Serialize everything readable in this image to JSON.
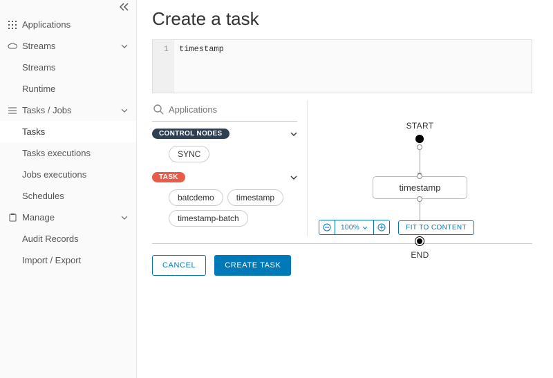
{
  "sidebar": {
    "applications": "Applications",
    "streams": {
      "label": "Streams",
      "items": [
        "Streams",
        "Runtime"
      ]
    },
    "tasks": {
      "label": "Tasks / Jobs",
      "items": [
        "Tasks",
        "Tasks executions",
        "Jobs executions",
        "Schedules"
      ]
    },
    "manage": {
      "label": "Manage",
      "items": [
        "Audit Records",
        "Import / Export"
      ]
    }
  },
  "page": {
    "title": "Create a task"
  },
  "editor": {
    "line_no": "1",
    "content": "timestamp"
  },
  "palette": {
    "search_placeholder": "Applications",
    "control_nodes": {
      "label": "CONTROL NODES",
      "items": [
        "SYNC"
      ]
    },
    "task": {
      "label": "TASK",
      "items": [
        "batcdemo",
        "timestamp",
        "timestamp-batch"
      ]
    }
  },
  "flow": {
    "start": "START",
    "end": "END",
    "node": "timestamp"
  },
  "zoom": {
    "value": "100%"
  },
  "buttons": {
    "fit": "FIT TO CONTENT",
    "cancel": "CANCEL",
    "create": "CREATE TASK"
  }
}
